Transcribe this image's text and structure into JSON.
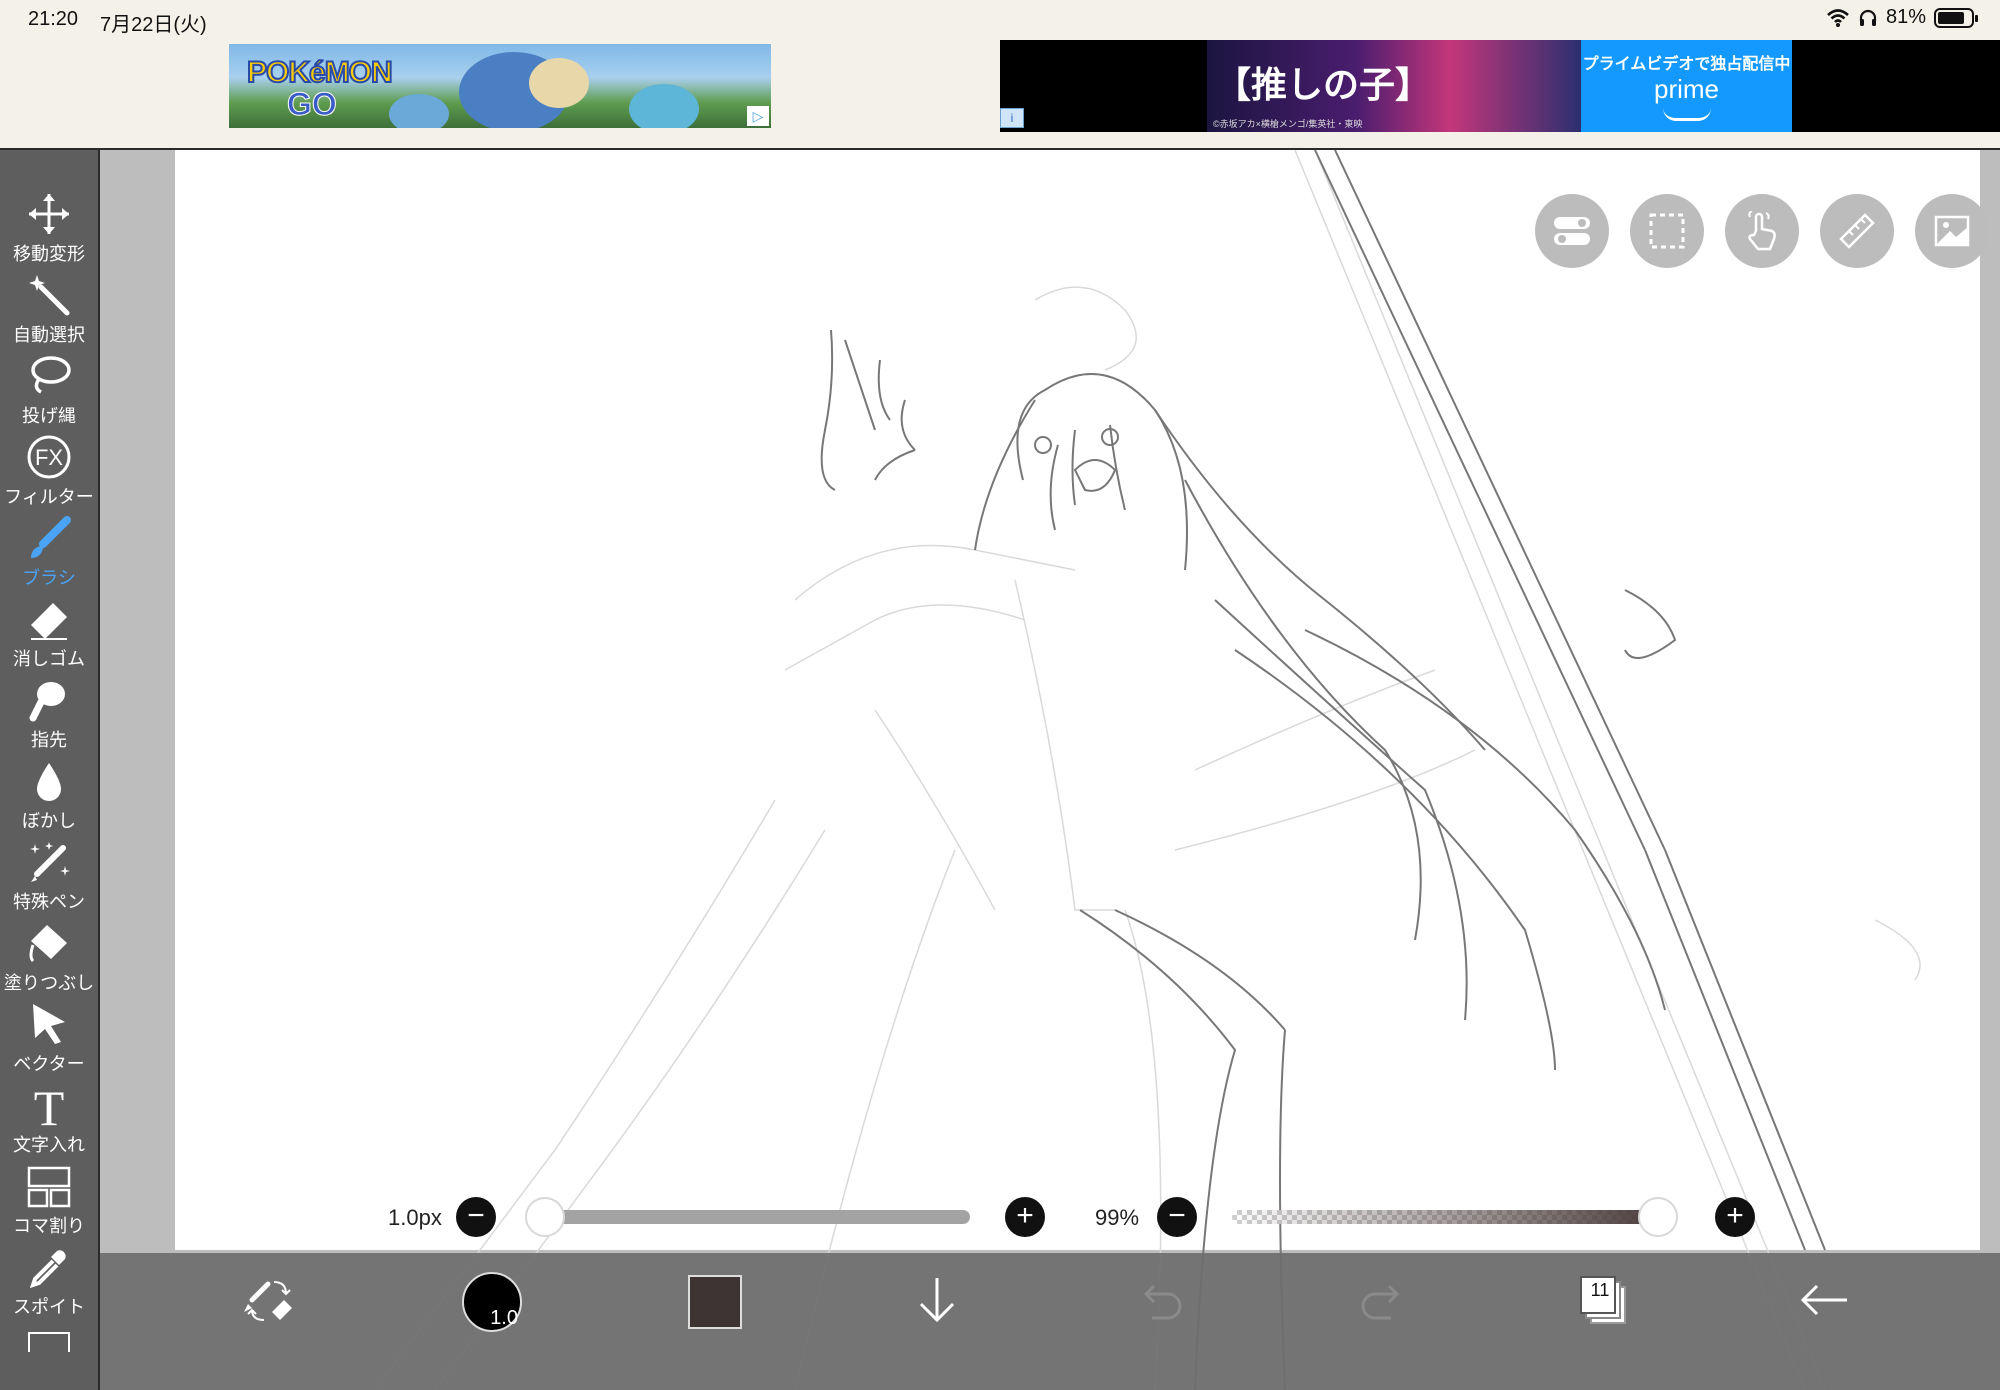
{
  "status_bar": {
    "time": "21:20",
    "date": "7月22日(火)",
    "battery": "81%",
    "battery_level": 0.81
  },
  "ads": {
    "left": {
      "logo_line1": "POKéMON",
      "logo_line2": "GO"
    },
    "right": {
      "title": "【推しの子】",
      "credit": "©赤坂アカ×横槍メンゴ/集英社・東映",
      "prime_line1": "プライムビデオで独占配信中",
      "prime_line2": "prime",
      "info_label": "i"
    }
  },
  "toolbar": {
    "active_index": 4,
    "tools": [
      {
        "id": "move",
        "label": "移動変形"
      },
      {
        "id": "magic-wand",
        "label": "自動選択"
      },
      {
        "id": "lasso",
        "label": "投げ縄"
      },
      {
        "id": "filter",
        "label": "フィルター",
        "icon_text": "FX"
      },
      {
        "id": "brush",
        "label": "ブラシ"
      },
      {
        "id": "eraser",
        "label": "消しゴム"
      },
      {
        "id": "finger",
        "label": "指先"
      },
      {
        "id": "blur",
        "label": "ぼかし"
      },
      {
        "id": "special-pen",
        "label": "特殊ペン"
      },
      {
        "id": "fill",
        "label": "塗りつぶし"
      },
      {
        "id": "vector",
        "label": "ベクター"
      },
      {
        "id": "text",
        "label": "文字入れ",
        "icon_text": "T"
      },
      {
        "id": "frame",
        "label": "コマ割り"
      },
      {
        "id": "eyedropper",
        "label": "スポイト"
      }
    ]
  },
  "canvas_buttons": [
    "toggle-icon",
    "selection-icon",
    "touch-icon",
    "ruler-icon",
    "image-icon"
  ],
  "brush_size": {
    "value_label": "1.0px",
    "level": 0.0,
    "minus": "−",
    "plus": "+"
  },
  "opacity": {
    "value_label": "99%",
    "level": 0.99,
    "minus": "−",
    "plus": "+"
  },
  "bottom_bar": {
    "brush_size_badge": "1.0",
    "color_swatch": "#3d3433",
    "layer_count": "11"
  },
  "colors": {
    "toolbar_bg": "#5e5e5e",
    "accent": "#4aa3f5",
    "canvas_bg": "#bdbdbd"
  }
}
